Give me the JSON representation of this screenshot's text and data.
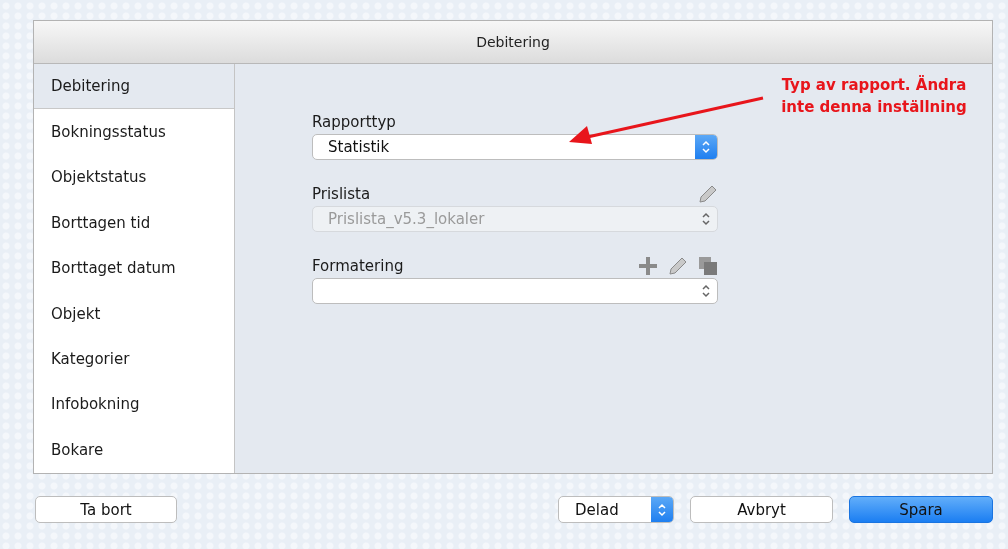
{
  "window": {
    "title": "Debitering"
  },
  "sidebar": {
    "items": [
      {
        "label": "Debitering",
        "selected": true
      },
      {
        "label": "Bokningsstatus",
        "selected": false
      },
      {
        "label": "Objektstatus",
        "selected": false
      },
      {
        "label": "Borttagen tid",
        "selected": false
      },
      {
        "label": "Borttaget datum",
        "selected": false
      },
      {
        "label": "Objekt",
        "selected": false
      },
      {
        "label": "Kategorier",
        "selected": false
      },
      {
        "label": "Infobokning",
        "selected": false
      },
      {
        "label": "Bokare",
        "selected": false
      }
    ]
  },
  "fields": [
    {
      "label": "Rapporttyp",
      "value": "Statistik",
      "disabled": false
    },
    {
      "label": "Prislista",
      "value": "Prislista_v5.3_lokaler",
      "disabled": true,
      "actions": [
        {
          "kind": "edit"
        }
      ]
    },
    {
      "label": "Formatering",
      "disabled": false,
      "actions": [
        {
          "kind": "add"
        },
        {
          "kind": "edit"
        },
        {
          "kind": "copy"
        }
      ]
    }
  ],
  "annotation": {
    "text": "Typ av rapport. Ändra inte denna inställning"
  },
  "footer": {
    "delete_button": "Ta bort",
    "sharing": {
      "value": "Delad"
    },
    "cancel_button": "Avbryt",
    "save_button": "Spara"
  }
}
